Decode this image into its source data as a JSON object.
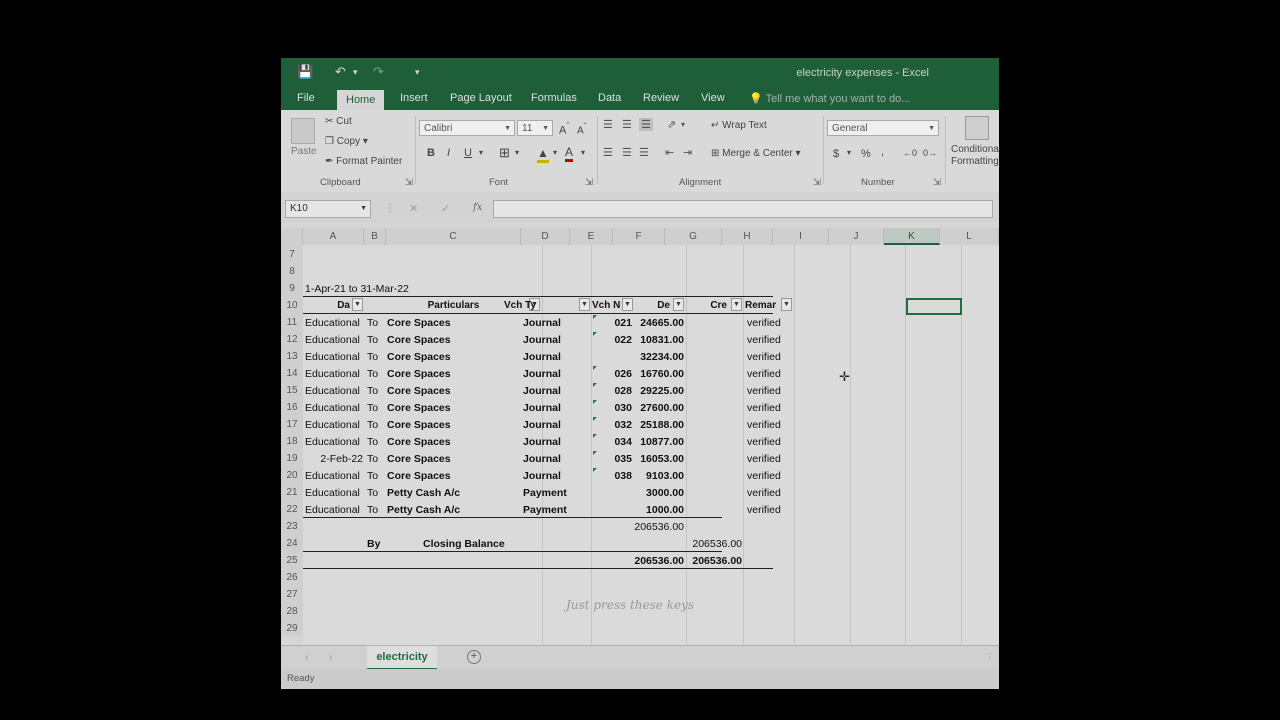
{
  "app": {
    "title": "electricity expenses - Excel"
  },
  "ribbon_tabs": [
    "File",
    "Home",
    "Insert",
    "Page Layout",
    "Formulas",
    "Data",
    "Review",
    "View"
  ],
  "active_tab": "Home",
  "tell_me": "Tell me what you want to do...",
  "clipboard": {
    "paste": "Paste",
    "cut": "Cut",
    "copy": "Copy",
    "format_painter": "Format Painter",
    "label": "Clipboard"
  },
  "font": {
    "name": "Calibri",
    "size": "11",
    "bold": "B",
    "italic": "I",
    "underline": "U",
    "label": "Font"
  },
  "alignment": {
    "wrap_text": "Wrap Text",
    "merge_center": "Merge & Center",
    "label": "Alignment"
  },
  "number": {
    "format": "General",
    "currency": "$",
    "percent": "%",
    "comma": ",",
    "label": "Number"
  },
  "styles": {
    "conditional": "Conditional Formatting"
  },
  "formula_bar": {
    "name_box": "K10",
    "cancel": "✕",
    "enter": "✓",
    "fx": "fx",
    "value": ""
  },
  "columns": [
    "A",
    "B",
    "C",
    "D",
    "E",
    "F",
    "G",
    "H",
    "I",
    "J",
    "K",
    "L"
  ],
  "rows": [
    "7",
    "8",
    "9",
    "10",
    "11",
    "12",
    "13",
    "14",
    "15",
    "16",
    "17",
    "18",
    "19",
    "20",
    "21",
    "22",
    "23",
    "24",
    "25",
    "26",
    "27",
    "28",
    "29"
  ],
  "sheet": {
    "period": "1-Apr-21 to 31-Mar-22",
    "headers": {
      "date": "Da",
      "particulars": "Particulars",
      "vch_type": "Vch Ty",
      "vch_no": "Vch N",
      "debit": "De",
      "credit": "Cre",
      "remarks": "Remar"
    },
    "entries": [
      {
        "a": "Educational",
        "b": "To",
        "c": "Core Spaces",
        "d": "Journal",
        "e": "021",
        "f": "24665.00",
        "h": "verified"
      },
      {
        "a": "Educational",
        "b": "To",
        "c": "Core Spaces",
        "d": "Journal",
        "e": "022",
        "f": "10831.00",
        "h": "verified"
      },
      {
        "a": "Educational",
        "b": "To",
        "c": "Core Spaces",
        "d": "Journal",
        "e": "",
        "f": "32234.00",
        "h": "verified"
      },
      {
        "a": "Educational",
        "b": "To",
        "c": "Core Spaces",
        "d": "Journal",
        "e": "026",
        "f": "16760.00",
        "h": "verified"
      },
      {
        "a": "Educational",
        "b": "To",
        "c": "Core Spaces",
        "d": "Journal",
        "e": "028",
        "f": "29225.00",
        "h": "verified"
      },
      {
        "a": "Educational",
        "b": "To",
        "c": "Core Spaces",
        "d": "Journal",
        "e": "030",
        "f": "27600.00",
        "h": "verified"
      },
      {
        "a": "Educational",
        "b": "To",
        "c": "Core Spaces",
        "d": "Journal",
        "e": "032",
        "f": "25188.00",
        "h": "verified"
      },
      {
        "a": "Educational",
        "b": "To",
        "c": "Core Spaces",
        "d": "Journal",
        "e": "034",
        "f": "10877.00",
        "h": "verified"
      },
      {
        "a": "2-Feb-22",
        "b": "To",
        "c": "Core Spaces",
        "d": "Journal",
        "e": "035",
        "f": "16053.00",
        "h": "verified"
      },
      {
        "a": "Educational",
        "b": "To",
        "c": "Core Spaces",
        "d": "Journal",
        "e": "038",
        "f": "9103.00",
        "h": "verified"
      },
      {
        "a": "Educational",
        "b": "To",
        "c": "Petty Cash A/c",
        "d": "Payment",
        "e": "",
        "f": "3000.00",
        "h": "verified"
      },
      {
        "a": "Educational",
        "b": "To",
        "c": "Petty Cash A/c",
        "d": "Payment",
        "e": "",
        "f": "1000.00",
        "h": "verified"
      }
    ],
    "subtotal_debit": "206536.00",
    "closing_by": "By",
    "closing_label": "Closing Balance",
    "closing_credit": "206536.00",
    "total_debit": "206536.00",
    "total_credit": "206536.00"
  },
  "caption": "Just press these keys",
  "sheet_tab": "electricity",
  "status": "Ready"
}
